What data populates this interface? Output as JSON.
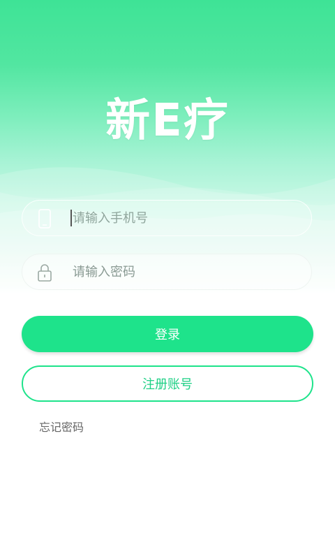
{
  "app": {
    "logo_text": "新E疗"
  },
  "login": {
    "phone_placeholder": "请输入手机号",
    "phone_value": "",
    "password_placeholder": "请输入密码",
    "password_value": "",
    "login_button": "登录",
    "register_button": "注册账号",
    "forgot_password": "忘记密码"
  },
  "icons": {
    "phone": "phone-icon",
    "password": "lock-icon"
  },
  "colors": {
    "primary": "#1ee38b",
    "header_top": "#3ee396",
    "text_muted": "#666666"
  }
}
